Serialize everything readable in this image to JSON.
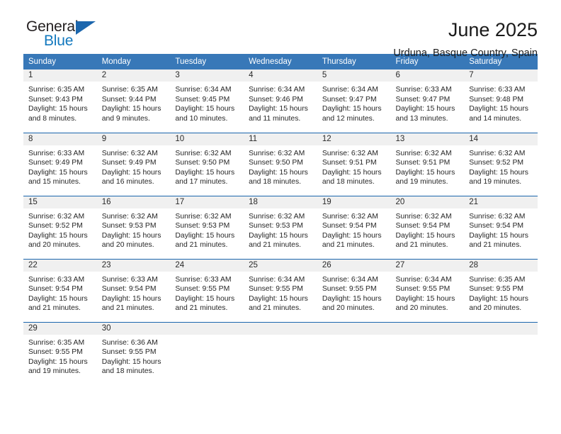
{
  "brand": {
    "name_top": "General",
    "name_bottom": "Blue",
    "accent_color": "#1b66ad",
    "text_color": "#231f20",
    "blue_text_color": "#1278be"
  },
  "header": {
    "title": "June 2025",
    "subtitle": "Urduna, Basque Country, Spain"
  },
  "theme": {
    "header_bg": "#3878b8",
    "header_text": "#ffffff",
    "row_rule": "#1b66ad",
    "daynum_bg": "#f0f0f0",
    "body_text": "#262626"
  },
  "weekday_headers": [
    "Sunday",
    "Monday",
    "Tuesday",
    "Wednesday",
    "Thursday",
    "Friday",
    "Saturday"
  ],
  "weeks": [
    [
      {
        "day": "1",
        "sunrise": "Sunrise: 6:35 AM",
        "sunset": "Sunset: 9:43 PM",
        "daylight": "Daylight: 15 hours and 8 minutes."
      },
      {
        "day": "2",
        "sunrise": "Sunrise: 6:35 AM",
        "sunset": "Sunset: 9:44 PM",
        "daylight": "Daylight: 15 hours and 9 minutes."
      },
      {
        "day": "3",
        "sunrise": "Sunrise: 6:34 AM",
        "sunset": "Sunset: 9:45 PM",
        "daylight": "Daylight: 15 hours and 10 minutes."
      },
      {
        "day": "4",
        "sunrise": "Sunrise: 6:34 AM",
        "sunset": "Sunset: 9:46 PM",
        "daylight": "Daylight: 15 hours and 11 minutes."
      },
      {
        "day": "5",
        "sunrise": "Sunrise: 6:34 AM",
        "sunset": "Sunset: 9:47 PM",
        "daylight": "Daylight: 15 hours and 12 minutes."
      },
      {
        "day": "6",
        "sunrise": "Sunrise: 6:33 AM",
        "sunset": "Sunset: 9:47 PM",
        "daylight": "Daylight: 15 hours and 13 minutes."
      },
      {
        "day": "7",
        "sunrise": "Sunrise: 6:33 AM",
        "sunset": "Sunset: 9:48 PM",
        "daylight": "Daylight: 15 hours and 14 minutes."
      }
    ],
    [
      {
        "day": "8",
        "sunrise": "Sunrise: 6:33 AM",
        "sunset": "Sunset: 9:49 PM",
        "daylight": "Daylight: 15 hours and 15 minutes."
      },
      {
        "day": "9",
        "sunrise": "Sunrise: 6:32 AM",
        "sunset": "Sunset: 9:49 PM",
        "daylight": "Daylight: 15 hours and 16 minutes."
      },
      {
        "day": "10",
        "sunrise": "Sunrise: 6:32 AM",
        "sunset": "Sunset: 9:50 PM",
        "daylight": "Daylight: 15 hours and 17 minutes."
      },
      {
        "day": "11",
        "sunrise": "Sunrise: 6:32 AM",
        "sunset": "Sunset: 9:50 PM",
        "daylight": "Daylight: 15 hours and 18 minutes."
      },
      {
        "day": "12",
        "sunrise": "Sunrise: 6:32 AM",
        "sunset": "Sunset: 9:51 PM",
        "daylight": "Daylight: 15 hours and 18 minutes."
      },
      {
        "day": "13",
        "sunrise": "Sunrise: 6:32 AM",
        "sunset": "Sunset: 9:51 PM",
        "daylight": "Daylight: 15 hours and 19 minutes."
      },
      {
        "day": "14",
        "sunrise": "Sunrise: 6:32 AM",
        "sunset": "Sunset: 9:52 PM",
        "daylight": "Daylight: 15 hours and 19 minutes."
      }
    ],
    [
      {
        "day": "15",
        "sunrise": "Sunrise: 6:32 AM",
        "sunset": "Sunset: 9:52 PM",
        "daylight": "Daylight: 15 hours and 20 minutes."
      },
      {
        "day": "16",
        "sunrise": "Sunrise: 6:32 AM",
        "sunset": "Sunset: 9:53 PM",
        "daylight": "Daylight: 15 hours and 20 minutes."
      },
      {
        "day": "17",
        "sunrise": "Sunrise: 6:32 AM",
        "sunset": "Sunset: 9:53 PM",
        "daylight": "Daylight: 15 hours and 21 minutes."
      },
      {
        "day": "18",
        "sunrise": "Sunrise: 6:32 AM",
        "sunset": "Sunset: 9:53 PM",
        "daylight": "Daylight: 15 hours and 21 minutes."
      },
      {
        "day": "19",
        "sunrise": "Sunrise: 6:32 AM",
        "sunset": "Sunset: 9:54 PM",
        "daylight": "Daylight: 15 hours and 21 minutes."
      },
      {
        "day": "20",
        "sunrise": "Sunrise: 6:32 AM",
        "sunset": "Sunset: 9:54 PM",
        "daylight": "Daylight: 15 hours and 21 minutes."
      },
      {
        "day": "21",
        "sunrise": "Sunrise: 6:32 AM",
        "sunset": "Sunset: 9:54 PM",
        "daylight": "Daylight: 15 hours and 21 minutes."
      }
    ],
    [
      {
        "day": "22",
        "sunrise": "Sunrise: 6:33 AM",
        "sunset": "Sunset: 9:54 PM",
        "daylight": "Daylight: 15 hours and 21 minutes."
      },
      {
        "day": "23",
        "sunrise": "Sunrise: 6:33 AM",
        "sunset": "Sunset: 9:54 PM",
        "daylight": "Daylight: 15 hours and 21 minutes."
      },
      {
        "day": "24",
        "sunrise": "Sunrise: 6:33 AM",
        "sunset": "Sunset: 9:55 PM",
        "daylight": "Daylight: 15 hours and 21 minutes."
      },
      {
        "day": "25",
        "sunrise": "Sunrise: 6:34 AM",
        "sunset": "Sunset: 9:55 PM",
        "daylight": "Daylight: 15 hours and 21 minutes."
      },
      {
        "day": "26",
        "sunrise": "Sunrise: 6:34 AM",
        "sunset": "Sunset: 9:55 PM",
        "daylight": "Daylight: 15 hours and 20 minutes."
      },
      {
        "day": "27",
        "sunrise": "Sunrise: 6:34 AM",
        "sunset": "Sunset: 9:55 PM",
        "daylight": "Daylight: 15 hours and 20 minutes."
      },
      {
        "day": "28",
        "sunrise": "Sunrise: 6:35 AM",
        "sunset": "Sunset: 9:55 PM",
        "daylight": "Daylight: 15 hours and 20 minutes."
      }
    ],
    [
      {
        "day": "29",
        "sunrise": "Sunrise: 6:35 AM",
        "sunset": "Sunset: 9:55 PM",
        "daylight": "Daylight: 15 hours and 19 minutes."
      },
      {
        "day": "30",
        "sunrise": "Sunrise: 6:36 AM",
        "sunset": "Sunset: 9:55 PM",
        "daylight": "Daylight: 15 hours and 18 minutes."
      },
      {
        "day": "",
        "sunrise": "",
        "sunset": "",
        "daylight": ""
      },
      {
        "day": "",
        "sunrise": "",
        "sunset": "",
        "daylight": ""
      },
      {
        "day": "",
        "sunrise": "",
        "sunset": "",
        "daylight": ""
      },
      {
        "day": "",
        "sunrise": "",
        "sunset": "",
        "daylight": ""
      },
      {
        "day": "",
        "sunrise": "",
        "sunset": "",
        "daylight": ""
      }
    ]
  ]
}
